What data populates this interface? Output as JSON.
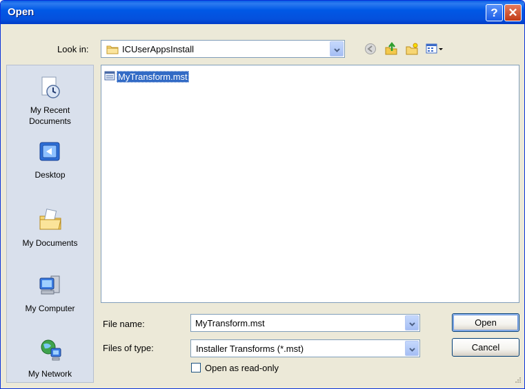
{
  "window": {
    "title": "Open",
    "help_label": "?",
    "close_label": "✕"
  },
  "lookin": {
    "label": "Look in:",
    "value": "ICUserAppsInstall"
  },
  "toolbar": {
    "icons": [
      "back-icon",
      "up-folder-icon",
      "new-folder-icon",
      "view-menu-icon"
    ]
  },
  "places": [
    {
      "label_line1": "My Recent",
      "label_line2": "Documents",
      "icon": "recent-documents-icon"
    },
    {
      "label_line1": "Desktop",
      "label_line2": "",
      "icon": "desktop-icon"
    },
    {
      "label_line1": "My Documents",
      "label_line2": "",
      "icon": "my-documents-icon"
    },
    {
      "label_line1": "My Computer",
      "label_line2": "",
      "icon": "my-computer-icon"
    },
    {
      "label_line1": "My Network",
      "label_line2": "",
      "icon": "my-network-icon"
    }
  ],
  "files": [
    {
      "name": "MyTransform.mst",
      "selected": true
    }
  ],
  "filename": {
    "label": "File name:",
    "value": "MyTransform.mst"
  },
  "filetype": {
    "label": "Files of type:",
    "value": "Installer Transforms (*.mst)"
  },
  "buttons": {
    "open": "Open",
    "cancel": "Cancel"
  },
  "readonly": {
    "label": "Open as read-only",
    "checked": false
  },
  "colors": {
    "titlebar": "#0058E6",
    "dialog_bg": "#ECE9D8",
    "selection": "#316AC5",
    "places_bg": "#D9E0EC"
  }
}
